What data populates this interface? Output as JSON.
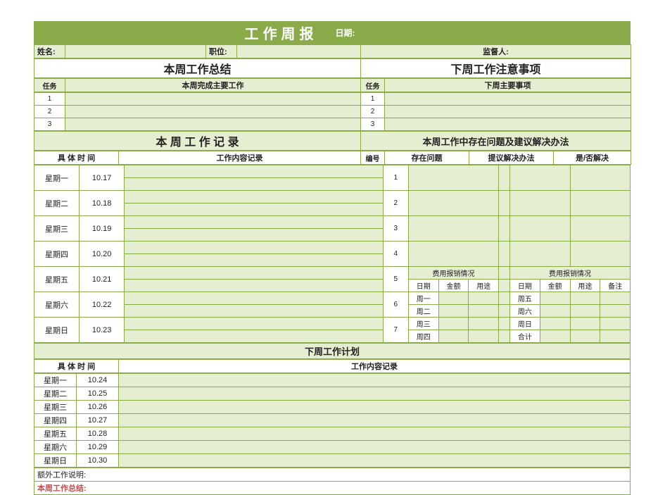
{
  "title": "工作周报",
  "date_label": "日期:",
  "row_labels": {
    "name": "姓名:",
    "position": "职位:",
    "supervisor": "监督人:"
  },
  "sections": {
    "summary_left": "本周工作总结",
    "summary_right": "下周工作注意事项",
    "task_hdr_left": "任务",
    "task_sub_left": "本周完成主要工作",
    "task_hdr_right": "任务",
    "task_sub_right": "下周主要事项",
    "record_left": "本 周 工 作 记 录",
    "record_right": "本周工作中存在问题及建议解决办法",
    "time_hdr": "具 体 时 间",
    "content_hdr": "工作内容记录",
    "idx_hdr": "编号",
    "problem_hdr": "存在问题",
    "solution_hdr": "提议解决办法",
    "resolved_hdr": "是/否解决",
    "expense_hdr": "费用报销情况",
    "exp_date": "日期",
    "exp_amt": "金额",
    "exp_use": "用途",
    "exp_note": "备注",
    "nextweek_plan": "下周工作计划",
    "extra": "额外工作说明:",
    "conclusion": "本周工作总结:"
  },
  "task_nums_left": [
    "1",
    "2",
    "3"
  ],
  "task_nums_right": [
    "1",
    "2",
    "3"
  ],
  "days_this": [
    {
      "d": "星期一",
      "dt": "10.17"
    },
    {
      "d": "星期二",
      "dt": "10.18"
    },
    {
      "d": "星期三",
      "dt": "10.19"
    },
    {
      "d": "星期四",
      "dt": "10.20"
    },
    {
      "d": "星期五",
      "dt": "10.21"
    },
    {
      "d": "星期六",
      "dt": "10.22"
    },
    {
      "d": "星期日",
      "dt": "10.23"
    }
  ],
  "idx_nums": [
    "1",
    "2",
    "3",
    "4",
    "5",
    "6",
    "7"
  ],
  "exp_left_rows": [
    "周一",
    "周二",
    "周三",
    "周四"
  ],
  "exp_right_rows": [
    "周五",
    "周六",
    "周日",
    "合计"
  ],
  "days_next": [
    {
      "d": "星期一",
      "dt": "10.24"
    },
    {
      "d": "星期二",
      "dt": "10.25"
    },
    {
      "d": "星期三",
      "dt": "10.26"
    },
    {
      "d": "星期四",
      "dt": "10.27"
    },
    {
      "d": "星期五",
      "dt": "10.28"
    },
    {
      "d": "星期六",
      "dt": "10.29"
    },
    {
      "d": "星期日",
      "dt": "10.30"
    }
  ]
}
